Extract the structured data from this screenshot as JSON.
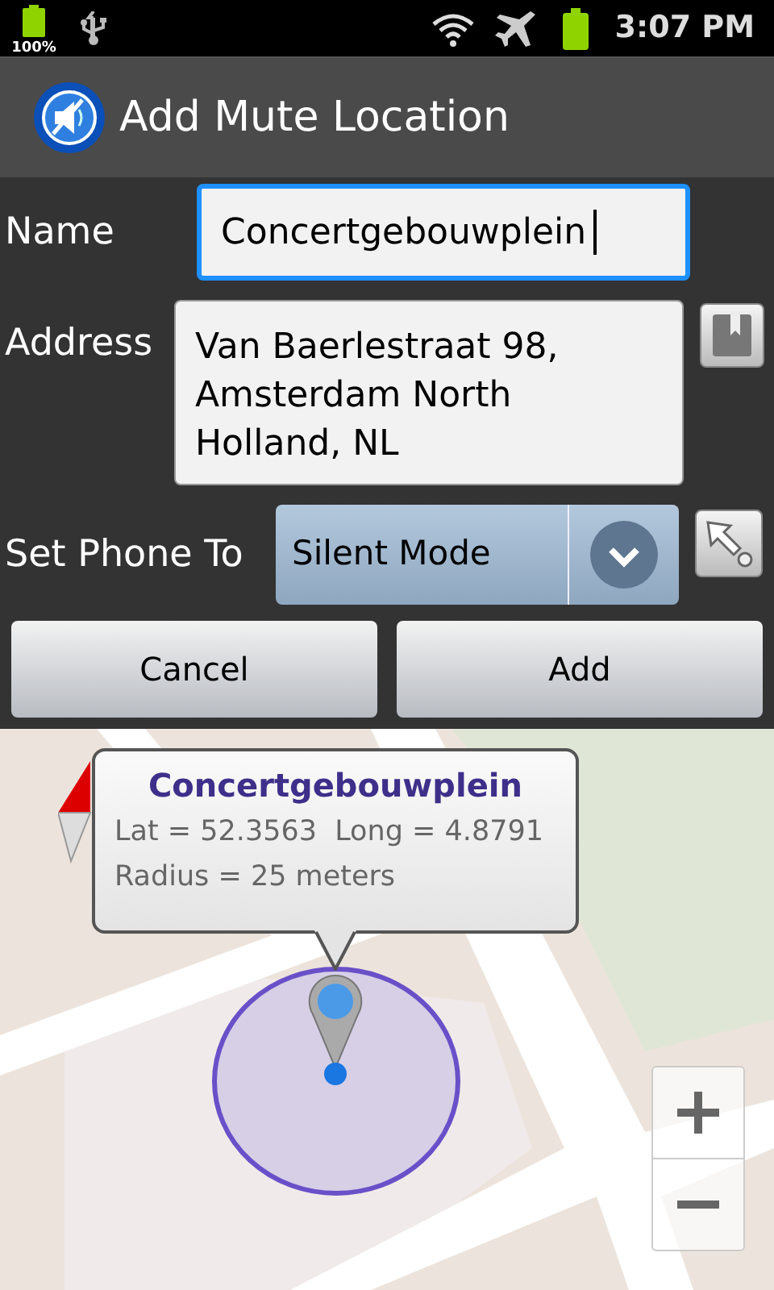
{
  "status_bar": {
    "battery_label": "100%",
    "time": "3:07 PM"
  },
  "title_bar": {
    "title": "Add Mute Location"
  },
  "form": {
    "name": {
      "label": "Name",
      "value": "Concertgebouwplein",
      "focused": true
    },
    "address": {
      "label": "Address",
      "value": "Van Baerlestraat 98,\nAmsterdam North\nHolland, NL"
    },
    "phone_mode": {
      "label": "Set Phone To",
      "value": "Silent Mode"
    }
  },
  "buttons": [
    {
      "label": "Cancel"
    },
    {
      "label": "Add"
    }
  ],
  "map": {
    "kind": "picture",
    "callout": {
      "title": "Concertgebouwplein",
      "coordinates": "Lat = 52.3563  Long = 4.8791",
      "radius": "Radius = 25 meters"
    }
  }
}
